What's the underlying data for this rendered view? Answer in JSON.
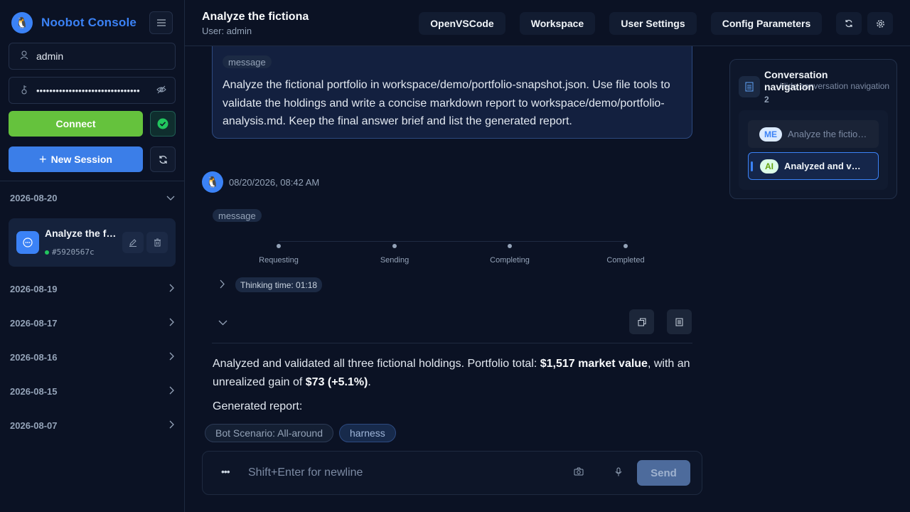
{
  "sidebar": {
    "brand": "Noobot Console",
    "username": "admin",
    "password_mask": "••••••••••••••••••••••••••••••••",
    "connect_label": "Connect",
    "new_session_label": "New Session",
    "groups": [
      {
        "date": "2026-08-20",
        "expanded": true
      },
      {
        "date": "2026-08-19",
        "expanded": false
      },
      {
        "date": "2026-08-17",
        "expanded": false
      },
      {
        "date": "2026-08-16",
        "expanded": false
      },
      {
        "date": "2026-08-15",
        "expanded": false
      },
      {
        "date": "2026-08-07",
        "expanded": false
      }
    ],
    "session": {
      "title": "Analyze the fictiona",
      "id": "#5920567c"
    }
  },
  "header": {
    "title": "Analyze the fictiona",
    "user": "User: admin",
    "buttons": [
      "OpenVSCode",
      "Workspace",
      "User Settings",
      "Config Parameters"
    ]
  },
  "conversation": {
    "user_message": {
      "tag": "message",
      "text": "Analyze the fictional portfolio in workspace/demo/portfolio-snapshot.json. Use file tools to validate the holdings and write a concise markdown report to workspace/demo/portfolio-analysis.md. Keep the final answer brief and list the generated report."
    },
    "ai_message": {
      "timestamp": "08/20/2026, 08:42 AM",
      "tag": "message",
      "steps": [
        "Requesting",
        "Sending",
        "Completing",
        "Completed"
      ],
      "thinking_time": "Thinking time: 01:18",
      "answer_part1": "Analyzed and validated all three fictional holdings. Portfolio total: ",
      "answer_bold1": "$1,517 market value",
      "answer_part2": ", with an unrealized gain of ",
      "answer_bold2": "$73 (+5.1%)",
      "answer_part3": ".",
      "generated_report": "Generated report:"
    },
    "chips": [
      "Bot Scenario: All-around",
      "harness"
    ]
  },
  "input": {
    "placeholder": "Shift+Enter for newline",
    "send_label": "Send"
  },
  "nav_panel": {
    "title": "Conversation navigation",
    "subtitle": "Hide conversation navigation",
    "count": "2",
    "items": [
      {
        "badge": "ME",
        "text": "Analyze the fictional portfolio in workspace/demo/portfolio-snapshot.json"
      },
      {
        "badge": "AI",
        "text": "Analyzed and validated all three fictional holdings"
      }
    ]
  },
  "colors": {
    "brand": "#3b82f6",
    "connect": "#65c23d",
    "new_session": "#3b7ee8",
    "background": "#0b1224",
    "status_dot": "#22c55e"
  }
}
